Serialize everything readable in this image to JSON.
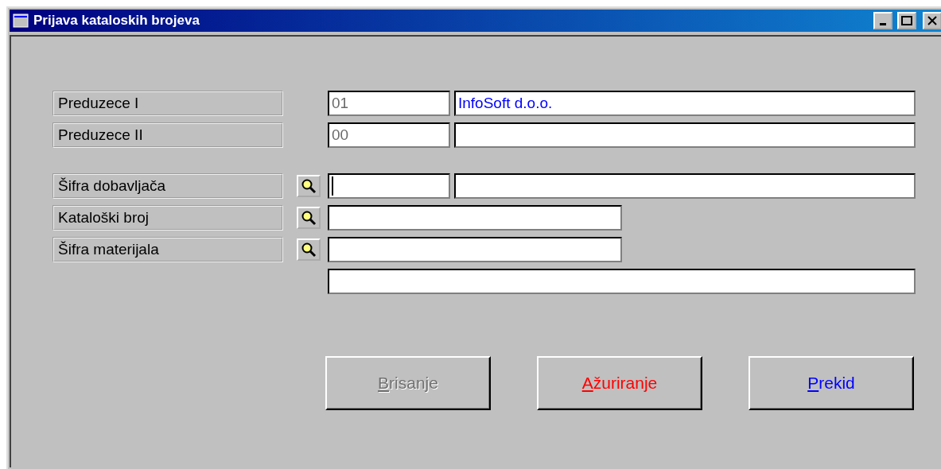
{
  "window": {
    "title": "Prijava kataloskih brojeva"
  },
  "rows": [
    {
      "kind": "pair",
      "label": "Preduzece I",
      "lookup": false,
      "code": {
        "value": "01",
        "disabled": true,
        "focused": false
      },
      "name": {
        "value": "InfoSoft d.o.o.",
        "focused": false
      }
    },
    {
      "kind": "pair",
      "label": "Preduzece II",
      "lookup": false,
      "code": {
        "value": "00",
        "disabled": true,
        "focused": false
      },
      "name": {
        "focused": false
      }
    },
    {
      "kind": "pair",
      "label": "Šifra dobavljača",
      "lookup": true,
      "code": {
        "disabled": false,
        "focused": true
      },
      "name": {
        "focused": false
      }
    },
    {
      "kind": "single",
      "label": "Kataloški broj",
      "lookup": true,
      "field": {
        "focused": false
      }
    },
    {
      "kind": "single",
      "label": "Šifra materijala",
      "lookup": true,
      "field": {
        "focused": false
      }
    },
    {
      "kind": "wide",
      "field": {
        "focused": false
      }
    }
  ],
  "buttons": [
    {
      "label": "Brisanje",
      "disabled": true
    },
    {
      "label": "Ažuriranje",
      "disabled": false,
      "color": "#ff0000"
    },
    {
      "label": "Prekid",
      "disabled": false,
      "color": "#0000ff"
    }
  ]
}
